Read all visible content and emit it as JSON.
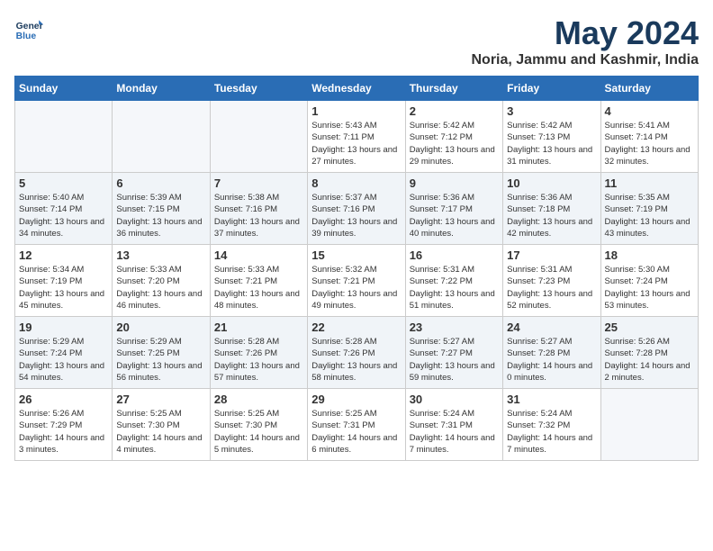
{
  "logo": {
    "line1": "General",
    "line2": "Blue"
  },
  "title": "May 2024",
  "location": "Noria, Jammu and Kashmir, India",
  "days_header": [
    "Sunday",
    "Monday",
    "Tuesday",
    "Wednesday",
    "Thursday",
    "Friday",
    "Saturday"
  ],
  "weeks": [
    [
      {
        "num": "",
        "sunrise": "",
        "sunset": "",
        "daylight": ""
      },
      {
        "num": "",
        "sunrise": "",
        "sunset": "",
        "daylight": ""
      },
      {
        "num": "",
        "sunrise": "",
        "sunset": "",
        "daylight": ""
      },
      {
        "num": "1",
        "sunrise": "Sunrise: 5:43 AM",
        "sunset": "Sunset: 7:11 PM",
        "daylight": "Daylight: 13 hours and 27 minutes."
      },
      {
        "num": "2",
        "sunrise": "Sunrise: 5:42 AM",
        "sunset": "Sunset: 7:12 PM",
        "daylight": "Daylight: 13 hours and 29 minutes."
      },
      {
        "num": "3",
        "sunrise": "Sunrise: 5:42 AM",
        "sunset": "Sunset: 7:13 PM",
        "daylight": "Daylight: 13 hours and 31 minutes."
      },
      {
        "num": "4",
        "sunrise": "Sunrise: 5:41 AM",
        "sunset": "Sunset: 7:14 PM",
        "daylight": "Daylight: 13 hours and 32 minutes."
      }
    ],
    [
      {
        "num": "5",
        "sunrise": "Sunrise: 5:40 AM",
        "sunset": "Sunset: 7:14 PM",
        "daylight": "Daylight: 13 hours and 34 minutes."
      },
      {
        "num": "6",
        "sunrise": "Sunrise: 5:39 AM",
        "sunset": "Sunset: 7:15 PM",
        "daylight": "Daylight: 13 hours and 36 minutes."
      },
      {
        "num": "7",
        "sunrise": "Sunrise: 5:38 AM",
        "sunset": "Sunset: 7:16 PM",
        "daylight": "Daylight: 13 hours and 37 minutes."
      },
      {
        "num": "8",
        "sunrise": "Sunrise: 5:37 AM",
        "sunset": "Sunset: 7:16 PM",
        "daylight": "Daylight: 13 hours and 39 minutes."
      },
      {
        "num": "9",
        "sunrise": "Sunrise: 5:36 AM",
        "sunset": "Sunset: 7:17 PM",
        "daylight": "Daylight: 13 hours and 40 minutes."
      },
      {
        "num": "10",
        "sunrise": "Sunrise: 5:36 AM",
        "sunset": "Sunset: 7:18 PM",
        "daylight": "Daylight: 13 hours and 42 minutes."
      },
      {
        "num": "11",
        "sunrise": "Sunrise: 5:35 AM",
        "sunset": "Sunset: 7:19 PM",
        "daylight": "Daylight: 13 hours and 43 minutes."
      }
    ],
    [
      {
        "num": "12",
        "sunrise": "Sunrise: 5:34 AM",
        "sunset": "Sunset: 7:19 PM",
        "daylight": "Daylight: 13 hours and 45 minutes."
      },
      {
        "num": "13",
        "sunrise": "Sunrise: 5:33 AM",
        "sunset": "Sunset: 7:20 PM",
        "daylight": "Daylight: 13 hours and 46 minutes."
      },
      {
        "num": "14",
        "sunrise": "Sunrise: 5:33 AM",
        "sunset": "Sunset: 7:21 PM",
        "daylight": "Daylight: 13 hours and 48 minutes."
      },
      {
        "num": "15",
        "sunrise": "Sunrise: 5:32 AM",
        "sunset": "Sunset: 7:21 PM",
        "daylight": "Daylight: 13 hours and 49 minutes."
      },
      {
        "num": "16",
        "sunrise": "Sunrise: 5:31 AM",
        "sunset": "Sunset: 7:22 PM",
        "daylight": "Daylight: 13 hours and 51 minutes."
      },
      {
        "num": "17",
        "sunrise": "Sunrise: 5:31 AM",
        "sunset": "Sunset: 7:23 PM",
        "daylight": "Daylight: 13 hours and 52 minutes."
      },
      {
        "num": "18",
        "sunrise": "Sunrise: 5:30 AM",
        "sunset": "Sunset: 7:24 PM",
        "daylight": "Daylight: 13 hours and 53 minutes."
      }
    ],
    [
      {
        "num": "19",
        "sunrise": "Sunrise: 5:29 AM",
        "sunset": "Sunset: 7:24 PM",
        "daylight": "Daylight: 13 hours and 54 minutes."
      },
      {
        "num": "20",
        "sunrise": "Sunrise: 5:29 AM",
        "sunset": "Sunset: 7:25 PM",
        "daylight": "Daylight: 13 hours and 56 minutes."
      },
      {
        "num": "21",
        "sunrise": "Sunrise: 5:28 AM",
        "sunset": "Sunset: 7:26 PM",
        "daylight": "Daylight: 13 hours and 57 minutes."
      },
      {
        "num": "22",
        "sunrise": "Sunrise: 5:28 AM",
        "sunset": "Sunset: 7:26 PM",
        "daylight": "Daylight: 13 hours and 58 minutes."
      },
      {
        "num": "23",
        "sunrise": "Sunrise: 5:27 AM",
        "sunset": "Sunset: 7:27 PM",
        "daylight": "Daylight: 13 hours and 59 minutes."
      },
      {
        "num": "24",
        "sunrise": "Sunrise: 5:27 AM",
        "sunset": "Sunset: 7:28 PM",
        "daylight": "Daylight: 14 hours and 0 minutes."
      },
      {
        "num": "25",
        "sunrise": "Sunrise: 5:26 AM",
        "sunset": "Sunset: 7:28 PM",
        "daylight": "Daylight: 14 hours and 2 minutes."
      }
    ],
    [
      {
        "num": "26",
        "sunrise": "Sunrise: 5:26 AM",
        "sunset": "Sunset: 7:29 PM",
        "daylight": "Daylight: 14 hours and 3 minutes."
      },
      {
        "num": "27",
        "sunrise": "Sunrise: 5:25 AM",
        "sunset": "Sunset: 7:30 PM",
        "daylight": "Daylight: 14 hours and 4 minutes."
      },
      {
        "num": "28",
        "sunrise": "Sunrise: 5:25 AM",
        "sunset": "Sunset: 7:30 PM",
        "daylight": "Daylight: 14 hours and 5 minutes."
      },
      {
        "num": "29",
        "sunrise": "Sunrise: 5:25 AM",
        "sunset": "Sunset: 7:31 PM",
        "daylight": "Daylight: 14 hours and 6 minutes."
      },
      {
        "num": "30",
        "sunrise": "Sunrise: 5:24 AM",
        "sunset": "Sunset: 7:31 PM",
        "daylight": "Daylight: 14 hours and 7 minutes."
      },
      {
        "num": "31",
        "sunrise": "Sunrise: 5:24 AM",
        "sunset": "Sunset: 7:32 PM",
        "daylight": "Daylight: 14 hours and 7 minutes."
      },
      {
        "num": "",
        "sunrise": "",
        "sunset": "",
        "daylight": ""
      }
    ]
  ]
}
